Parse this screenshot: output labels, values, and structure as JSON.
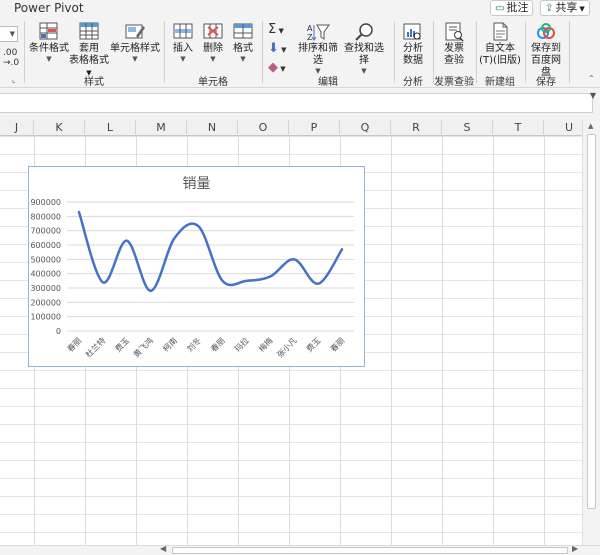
{
  "topbar": {
    "tab": "Power Pivot",
    "comment_button": "批注",
    "share_button": "共享"
  },
  "ribbon": {
    "partial_top": ".00",
    "partial_bottom": "→.0",
    "styles": {
      "conditional_format": "条件格式",
      "table_format": "套用",
      "table_format_2": "表格格式",
      "cell_styles": "单元格样式",
      "group": "样式"
    },
    "cells": {
      "insert": "插入",
      "delete": "删除",
      "format": "格式",
      "group": "单元格"
    },
    "editing": {
      "sort_filter": "排序和筛选",
      "find_select": "查找和选择",
      "group": "编辑"
    },
    "analysis": {
      "analyze_data": "分析",
      "analyze_data_2": "数据",
      "group": "分析"
    },
    "invoice": {
      "check": "发票",
      "check_2": "查验",
      "group": "发票查验"
    },
    "new_group": {
      "text": "自文本",
      "text_2": "(T)(旧版)",
      "group": "新建组"
    },
    "save": {
      "save_baidu": "保存到",
      "save_baidu_2": "百度网盘",
      "group": "保存"
    }
  },
  "columns": [
    "J",
    "K",
    "L",
    "M",
    "N",
    "O",
    "P",
    "Q",
    "R",
    "S",
    "T",
    "U"
  ],
  "colors": {
    "line": "#4472c4",
    "gridline": "#d9d9d9",
    "chart_border": "#9ab3cf"
  },
  "chart_data": {
    "type": "line",
    "title": "销量",
    "smooth": true,
    "categories": [
      "春丽",
      "杜兰特",
      "费玉",
      "黄飞鸿",
      "柯南",
      "刘冬",
      "春丽",
      "玛拉",
      "梅梅",
      "张小凡",
      "费玉",
      "春丽"
    ],
    "series": [
      {
        "values": [
          830000,
          340000,
          630000,
          280000,
          650000,
          730000,
          350000,
          350000,
          380000,
          500000,
          330000,
          570000
        ]
      }
    ],
    "ylim": [
      0,
      900000
    ],
    "yticks": [
      "0",
      "100000",
      "200000",
      "300000",
      "400000",
      "500000",
      "600000",
      "700000",
      "800000",
      "900000"
    ],
    "grid": true,
    "legend": "none"
  }
}
